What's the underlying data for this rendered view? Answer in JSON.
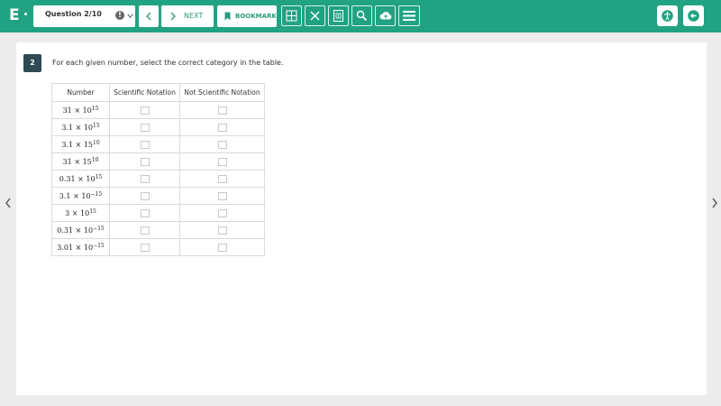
{
  "app": {
    "logo_letter": "E"
  },
  "toolbar": {
    "question_label": "Question 2/10",
    "next_label": "NEXT",
    "bookmark_label": "BOOKMARK"
  },
  "question": {
    "number": "2",
    "prompt": "For each given number, select the correct category in the table."
  },
  "table": {
    "headers": [
      "Number",
      "Scientific Notation",
      "Not Scientific Notation"
    ],
    "rows": [
      {
        "base": "31",
        "times": "×",
        "power": "10",
        "exp": "15"
      },
      {
        "base": "3.1",
        "times": "×",
        "power": "10",
        "exp": "15"
      },
      {
        "base": "3.1",
        "times": "×",
        "power": "15",
        "exp": "10"
      },
      {
        "base": "31",
        "times": "×",
        "power": "15",
        "exp": "10"
      },
      {
        "base": "0.31",
        "times": "×",
        "power": "10",
        "exp": "15"
      },
      {
        "base": "3.1",
        "times": "×",
        "power": "10",
        "exp": "−15"
      },
      {
        "base": "3",
        "times": "×",
        "power": "10",
        "exp": "15"
      },
      {
        "base": "0.31",
        "times": "×",
        "power": "10",
        "exp": "−15"
      },
      {
        "base": "3.01",
        "times": "×",
        "power": "10",
        "exp": "−15"
      }
    ]
  },
  "colors": {
    "topbar": "#21a383",
    "accent": "#2b9b7f",
    "badge": "#2e4a54"
  },
  "icons": [
    "warning-icon",
    "chevron-down-icon",
    "chevron-left-icon",
    "chevron-right-icon",
    "bookmark-icon",
    "grid-icon",
    "close-icon",
    "calculator-icon",
    "search-icon",
    "cloud-upload-icon",
    "menu-icon",
    "accessibility-icon",
    "exit-icon"
  ]
}
